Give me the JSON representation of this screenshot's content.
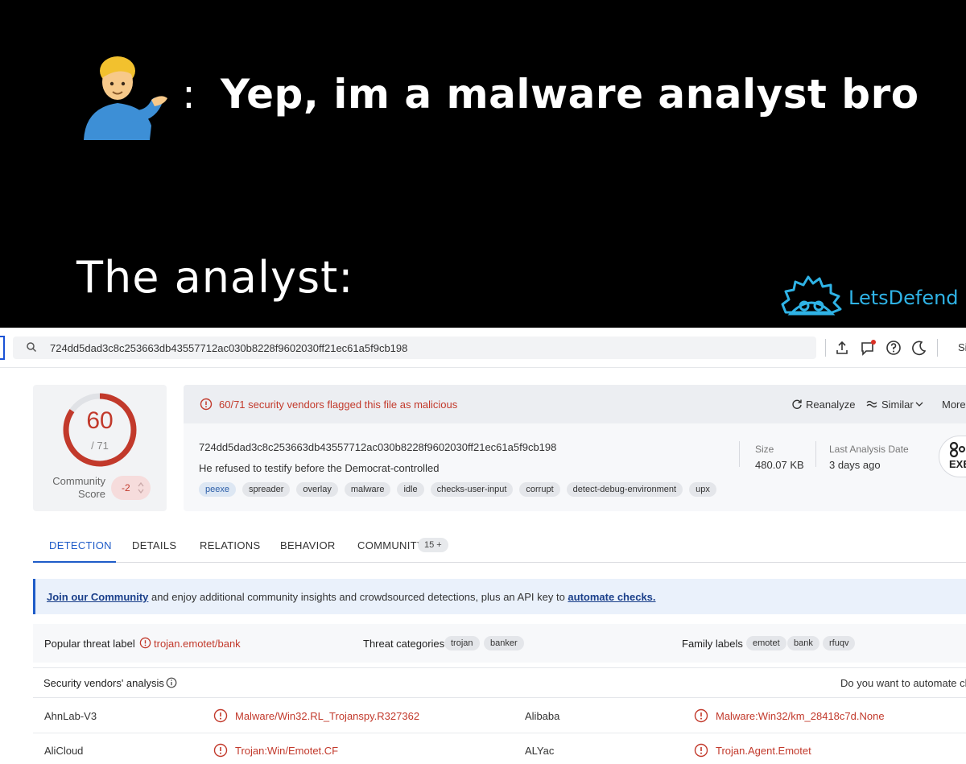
{
  "meme": {
    "colon": ":",
    "caption": "Yep, im a malware analyst bro",
    "bottom_text": "The analyst:",
    "logo_text": "LetsDefend",
    "emoji_icon": "person-tipping-hand-emoji",
    "accent": "#2fb3e6"
  },
  "topbar": {
    "search_value": "724dd5dad3c8c253663db43557712ac030b8228f9602030ff21ec61a5f9cb198",
    "signin_label": "Si"
  },
  "score": {
    "detections": "60",
    "total": "/ 71",
    "detection_ratio": 0.845,
    "community_label_1": "Community",
    "community_label_2": "Score",
    "community_score": "-2",
    "color": "#c2392b"
  },
  "banner": {
    "message": "60/71 security vendors flagged this file as malicious",
    "reanalyze": "Reanalyze",
    "similar": "Similar",
    "more": "More"
  },
  "file": {
    "hash": "724dd5dad3c8c253663db43557712ac030b8228f9602030ff21ec61a5f9cb198",
    "name": "He refused to testify before the Democrat-controlled",
    "tags": [
      "peexe",
      "spreader",
      "overlay",
      "malware",
      "idle",
      "checks-user-input",
      "corrupt",
      "detect-debug-environment",
      "upx"
    ],
    "size_label": "Size",
    "size_value": "480.07 KB",
    "date_label": "Last Analysis Date",
    "date_value": "3 days ago",
    "type_badge": "EXE"
  },
  "tabs": {
    "detection": "DETECTION",
    "details": "DETAILS",
    "relations": "RELATIONS",
    "behavior": "BEHAVIOR",
    "community": "COMMUNITY",
    "community_count": "15 +"
  },
  "join": {
    "link1": "Join our Community",
    "middle": " and enjoy additional community insights and crowdsourced detections, plus an API key to ",
    "link2": "automate checks."
  },
  "threat": {
    "popular_label": "Popular threat label",
    "popular_value": "trojan.emotet/bank",
    "categories_label": "Threat categories",
    "categories": [
      "trojan",
      "banker"
    ],
    "family_label": "Family labels",
    "families": [
      "emotet",
      "bank",
      "rfuqv"
    ]
  },
  "vendors": {
    "title": "Security vendors' analysis",
    "prompt": "Do you want to automate che",
    "rows": [
      {
        "v1": "AhnLab-V3",
        "r1": "Malware/Win32.RL_Trojanspy.R327362",
        "v2": "Alibaba",
        "r2": "Malware:Win32/km_28418c7d.None"
      },
      {
        "v1": "AliCloud",
        "r1": "Trojan:Win/Emotet.CF",
        "v2": "ALYac",
        "r2": "Trojan.Agent.Emotet"
      }
    ]
  }
}
